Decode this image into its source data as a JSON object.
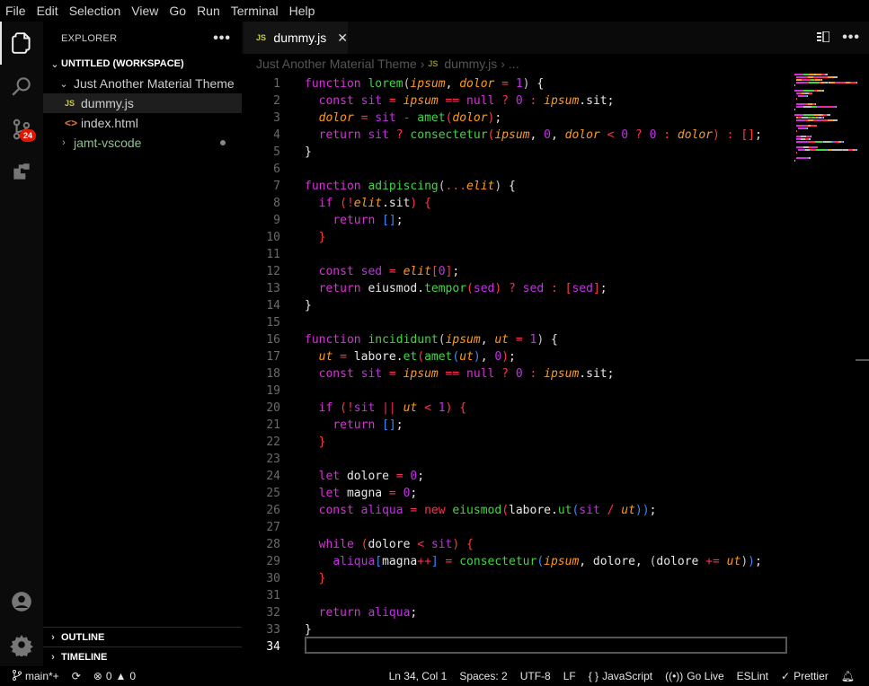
{
  "menu": [
    "File",
    "Edit",
    "Selection",
    "View",
    "Go",
    "Run",
    "Terminal",
    "Help"
  ],
  "activity_bar": {
    "items": [
      {
        "name": "explorer-icon"
      },
      {
        "name": "search-icon"
      },
      {
        "name": "source-control-icon",
        "badge": "24"
      },
      {
        "name": "extensions-icon"
      },
      {
        "name": "accounts-icon"
      },
      {
        "name": "settings-gear-icon"
      }
    ]
  },
  "sidebar": {
    "title": "EXPLORER",
    "workspace": "UNTITLED (WORKSPACE)",
    "folder": "Just Another Material Theme",
    "files": [
      {
        "name": "dummy.js",
        "type": "js"
      },
      {
        "name": "index.html",
        "type": "html"
      }
    ],
    "other_folder": "jamt-vscode",
    "outline": "OUTLINE",
    "timeline": "TIMELINE",
    "js_badge": "JS",
    "html_badge": "<>"
  },
  "editor": {
    "tab": {
      "label": "dummy.js",
      "icon": "JS"
    },
    "breadcrumbs": {
      "folder": "Just Another Material Theme",
      "file": "dummy.js",
      "more": "..."
    },
    "current_line": 34,
    "lines": [
      [
        [
          "kw",
          "function "
        ],
        [
          "fn",
          "lorem"
        ],
        [
          "br1",
          "("
        ],
        [
          "pa",
          "ipsum"
        ],
        [
          "pr",
          ", "
        ],
        [
          "pa",
          "dolor"
        ],
        [
          "op",
          " = "
        ],
        [
          "nu",
          "1"
        ],
        [
          "br1",
          ")"
        ],
        [
          "pr",
          " {"
        ]
      ],
      [
        [
          "pr",
          "  "
        ],
        [
          "kw",
          "const "
        ],
        [
          "nu",
          "sit"
        ],
        [
          "op",
          " = "
        ],
        [
          "pa",
          "ipsum"
        ],
        [
          "op",
          " == "
        ],
        [
          "kw",
          "null"
        ],
        [
          "op",
          " ? "
        ],
        [
          "nu",
          "0"
        ],
        [
          "op",
          " : "
        ],
        [
          "pa",
          "ipsum"
        ],
        [
          "pr",
          ".sit;"
        ]
      ],
      [
        [
          "pr",
          "  "
        ],
        [
          "pa",
          "dolor"
        ],
        [
          "op",
          " = "
        ],
        [
          "nu",
          "sit"
        ],
        [
          "op",
          " - "
        ],
        [
          "fn",
          "amet"
        ],
        [
          "br2",
          "("
        ],
        [
          "pa",
          "dolor"
        ],
        [
          "br2",
          ")"
        ],
        [
          "pr",
          ";"
        ]
      ],
      [
        [
          "pr",
          "  "
        ],
        [
          "kw",
          "return "
        ],
        [
          "nu",
          "sit"
        ],
        [
          "op",
          " ? "
        ],
        [
          "fn",
          "consectetur"
        ],
        [
          "br2",
          "("
        ],
        [
          "pa",
          "ipsum"
        ],
        [
          "pr",
          ", "
        ],
        [
          "nu",
          "0"
        ],
        [
          "pr",
          ", "
        ],
        [
          "pa",
          "dolor"
        ],
        [
          "op",
          " < "
        ],
        [
          "nu",
          "0"
        ],
        [
          "op",
          " ? "
        ],
        [
          "nu",
          "0"
        ],
        [
          "op",
          " : "
        ],
        [
          "pa",
          "dolor"
        ],
        [
          "br2",
          ")"
        ],
        [
          "op",
          " : "
        ],
        [
          "br2",
          "[]"
        ],
        [
          "pr",
          ";"
        ]
      ],
      [
        [
          "pr",
          "}"
        ]
      ],
      [],
      [
        [
          "kw",
          "function "
        ],
        [
          "fn",
          "adipiscing"
        ],
        [
          "br1",
          "("
        ],
        [
          "op",
          "..."
        ],
        [
          "pa",
          "elit"
        ],
        [
          "br1",
          ")"
        ],
        [
          "pr",
          " {"
        ]
      ],
      [
        [
          "pr",
          "  "
        ],
        [
          "kw",
          "if "
        ],
        [
          "br2",
          "("
        ],
        [
          "op",
          "!"
        ],
        [
          "pa",
          "elit"
        ],
        [
          "pr",
          ".sit"
        ],
        [
          "br2",
          ")"
        ],
        [
          "br2",
          " {"
        ]
      ],
      [
        [
          "pr",
          "    "
        ],
        [
          "kw",
          "return "
        ],
        [
          "br3",
          "[]"
        ],
        [
          "pr",
          ";"
        ]
      ],
      [
        [
          "pr",
          "  "
        ],
        [
          "br2",
          "}"
        ]
      ],
      [],
      [
        [
          "pr",
          "  "
        ],
        [
          "kw",
          "const "
        ],
        [
          "nu",
          "sed"
        ],
        [
          "op",
          " = "
        ],
        [
          "pa",
          "elit"
        ],
        [
          "br2",
          "["
        ],
        [
          "nu",
          "0"
        ],
        [
          "br2",
          "]"
        ],
        [
          "pr",
          ";"
        ]
      ],
      [
        [
          "pr",
          "  "
        ],
        [
          "kw",
          "return "
        ],
        [
          "pr",
          "eiusmod."
        ],
        [
          "fn",
          "tempor"
        ],
        [
          "br2",
          "("
        ],
        [
          "nu",
          "sed"
        ],
        [
          "br2",
          ")"
        ],
        [
          "op",
          " ? "
        ],
        [
          "nu",
          "sed"
        ],
        [
          "op",
          " : "
        ],
        [
          "br2",
          "["
        ],
        [
          "nu",
          "sed"
        ],
        [
          "br2",
          "]"
        ],
        [
          "pr",
          ";"
        ]
      ],
      [
        [
          "pr",
          "}"
        ]
      ],
      [],
      [
        [
          "kw",
          "function "
        ],
        [
          "fn",
          "incididunt"
        ],
        [
          "br1",
          "("
        ],
        [
          "pa",
          "ipsum"
        ],
        [
          "pr",
          ", "
        ],
        [
          "pa",
          "ut"
        ],
        [
          "op",
          " = "
        ],
        [
          "nu",
          "1"
        ],
        [
          "br1",
          ")"
        ],
        [
          "pr",
          " {"
        ]
      ],
      [
        [
          "pr",
          "  "
        ],
        [
          "pa",
          "ut"
        ],
        [
          "op",
          " = "
        ],
        [
          "pr",
          "labore."
        ],
        [
          "fn",
          "et"
        ],
        [
          "br2",
          "("
        ],
        [
          "fn",
          "amet"
        ],
        [
          "br3",
          "("
        ],
        [
          "pa",
          "ut"
        ],
        [
          "br3",
          ")"
        ],
        [
          "pr",
          ", "
        ],
        [
          "nu",
          "0"
        ],
        [
          "br2",
          ")"
        ],
        [
          "pr",
          ";"
        ]
      ],
      [
        [
          "pr",
          "  "
        ],
        [
          "kw",
          "const "
        ],
        [
          "nu",
          "sit"
        ],
        [
          "op",
          " = "
        ],
        [
          "pa",
          "ipsum"
        ],
        [
          "op",
          " == "
        ],
        [
          "kw",
          "null"
        ],
        [
          "op",
          " ? "
        ],
        [
          "nu",
          "0"
        ],
        [
          "op",
          " : "
        ],
        [
          "pa",
          "ipsum"
        ],
        [
          "pr",
          ".sit;"
        ]
      ],
      [],
      [
        [
          "pr",
          "  "
        ],
        [
          "kw",
          "if "
        ],
        [
          "br2",
          "("
        ],
        [
          "op",
          "!"
        ],
        [
          "nu",
          "sit"
        ],
        [
          "op",
          " || "
        ],
        [
          "pa",
          "ut"
        ],
        [
          "op",
          " < "
        ],
        [
          "nu",
          "1"
        ],
        [
          "br2",
          ")"
        ],
        [
          "br2",
          " {"
        ]
      ],
      [
        [
          "pr",
          "    "
        ],
        [
          "kw",
          "return "
        ],
        [
          "br3",
          "[]"
        ],
        [
          "pr",
          ";"
        ]
      ],
      [
        [
          "pr",
          "  "
        ],
        [
          "br2",
          "}"
        ]
      ],
      [],
      [
        [
          "pr",
          "  "
        ],
        [
          "kw",
          "let "
        ],
        [
          "pr",
          "dolore"
        ],
        [
          "op",
          " = "
        ],
        [
          "nu",
          "0"
        ],
        [
          "pr",
          ";"
        ]
      ],
      [
        [
          "pr",
          "  "
        ],
        [
          "kw",
          "let "
        ],
        [
          "pr",
          "magna"
        ],
        [
          "op",
          " = "
        ],
        [
          "nu",
          "0"
        ],
        [
          "pr",
          ";"
        ]
      ],
      [
        [
          "pr",
          "  "
        ],
        [
          "kw",
          "const "
        ],
        [
          "nu",
          "aliqua"
        ],
        [
          "op",
          " = "
        ],
        [
          "op",
          "new "
        ],
        [
          "fn",
          "eiusmod"
        ],
        [
          "br2",
          "("
        ],
        [
          "pr",
          "labore."
        ],
        [
          "fn",
          "ut"
        ],
        [
          "br3",
          "("
        ],
        [
          "nu",
          "sit"
        ],
        [
          "op",
          " / "
        ],
        [
          "pa",
          "ut"
        ],
        [
          "br3",
          "))"
        ],
        [
          "pr",
          ";"
        ]
      ],
      [],
      [
        [
          "pr",
          "  "
        ],
        [
          "kw",
          "while "
        ],
        [
          "br2",
          "("
        ],
        [
          "pr",
          "dolore"
        ],
        [
          "op",
          " < "
        ],
        [
          "nu",
          "sit"
        ],
        [
          "br2",
          ")"
        ],
        [
          "br2",
          " {"
        ]
      ],
      [
        [
          "pr",
          "    "
        ],
        [
          "nu",
          "aliqua"
        ],
        [
          "br3",
          "["
        ],
        [
          "pr",
          "magna"
        ],
        [
          "op",
          "++"
        ],
        [
          "br3",
          "]"
        ],
        [
          "op",
          " = "
        ],
        [
          "fn",
          "consectetur"
        ],
        [
          "br3",
          "("
        ],
        [
          "pa",
          "ipsum"
        ],
        [
          "pr",
          ", dolore, "
        ],
        [
          "br1",
          "("
        ],
        [
          "pr",
          "dolore"
        ],
        [
          "op",
          " += "
        ],
        [
          "pa",
          "ut"
        ],
        [
          "br1",
          ")"
        ],
        [
          "br3",
          ")"
        ],
        [
          "pr",
          ";"
        ]
      ],
      [
        [
          "pr",
          "  "
        ],
        [
          "br2",
          "}"
        ]
      ],
      [],
      [
        [
          "pr",
          "  "
        ],
        [
          "kw",
          "return "
        ],
        [
          "nu",
          "aliqua"
        ],
        [
          "pr",
          ";"
        ]
      ],
      [
        [
          "pr",
          "}"
        ]
      ],
      []
    ]
  },
  "status": {
    "branch": "main*+",
    "errors": "0",
    "warnings": "0",
    "position": "Ln 34, Col 1",
    "spaces": "Spaces: 2",
    "encoding": "UTF-8",
    "eol": "LF",
    "language": "JavaScript",
    "golive": "Go Live",
    "eslint": "ESLint",
    "prettier": "Prettier"
  }
}
